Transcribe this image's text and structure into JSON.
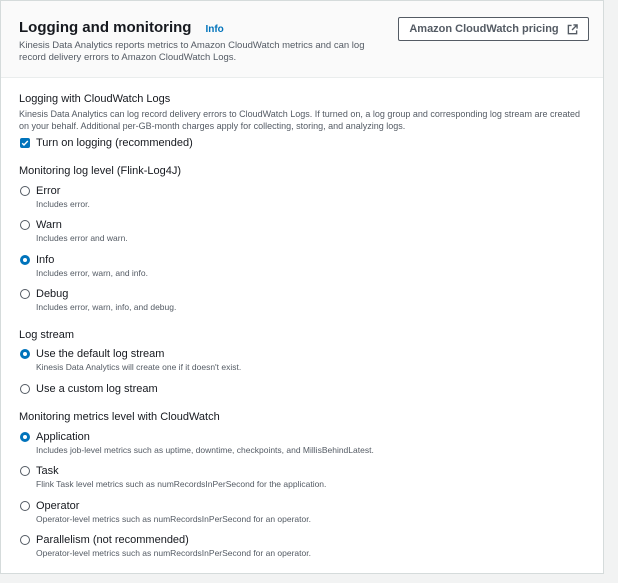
{
  "header": {
    "title": "Logging and monitoring",
    "info_link": "Info",
    "description": "Kinesis Data Analytics reports metrics to Amazon CloudWatch metrics and can log record delivery errors to Amazon CloudWatch Logs.",
    "pricing_button": "Amazon CloudWatch pricing"
  },
  "logging": {
    "label": "Logging with CloudWatch Logs",
    "description": "Kinesis Data Analytics can log record delivery errors to CloudWatch Logs. If turned on, a log group and corresponding log stream are created on your behalf. Additional per-GB-month charges apply for collecting, storing, and analyzing logs.",
    "checkbox_label": "Turn on logging (recommended)",
    "checked": true
  },
  "log_level": {
    "label": "Monitoring log level (Flink-Log4J)",
    "selected": "Info",
    "options": [
      {
        "label": "Error",
        "description": "Includes error."
      },
      {
        "label": "Warn",
        "description": "Includes error and warn."
      },
      {
        "label": "Info",
        "description": "Includes error, warn, and info."
      },
      {
        "label": "Debug",
        "description": "Includes error, warn, info, and debug."
      }
    ]
  },
  "log_stream": {
    "label": "Log stream",
    "selected": "Use the default log stream",
    "options": [
      {
        "label": "Use the default log stream",
        "description": "Kinesis Data Analytics will create one if it doesn't exist."
      },
      {
        "label": "Use a custom log stream",
        "description": ""
      }
    ]
  },
  "metrics_level": {
    "label": "Monitoring metrics level with CloudWatch",
    "selected": "Application",
    "options": [
      {
        "label": "Application",
        "description": "Includes job-level metrics such as uptime, downtime, checkpoints, and MillisBehindLatest."
      },
      {
        "label": "Task",
        "description": "Flink Task level metrics such as numRecordsInPerSecond for the application."
      },
      {
        "label": "Operator",
        "description": "Operator-level metrics such as numRecordsInPerSecond for an operator."
      },
      {
        "label": "Parallelism (not recommended)",
        "description": "Operator-level metrics such as numRecordsInPerSecond for an operator."
      }
    ]
  },
  "colors": {
    "accent": "#0073bb",
    "text": "#16191f",
    "muted": "#545b64",
    "header_bg": "#fafafa"
  }
}
